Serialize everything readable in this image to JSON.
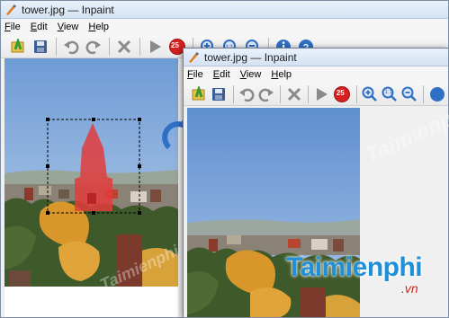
{
  "window_back": {
    "title": "tower.jpg — Inpaint",
    "menus": [
      "File",
      "Edit",
      "View",
      "Help"
    ],
    "menu_underline": [
      "F",
      "E",
      "V",
      "H"
    ],
    "badge_value": "25"
  },
  "window_front": {
    "title": "tower.jpg — Inpaint",
    "menus": [
      "File",
      "Edit",
      "View",
      "Help"
    ],
    "menu_underline": [
      "F",
      "E",
      "V",
      "H"
    ],
    "badge_value": "25",
    "zoom_reset_label": "1:1"
  },
  "watermark": {
    "brand": "Taimienphi",
    "tld": ".vn"
  },
  "colors": {
    "selection_mask": "#e23c3c",
    "toolbar_blue": "#2f6fc6",
    "badge_red": "#d62020",
    "sky": "#7fa6d9",
    "foliage": "#d9962a",
    "brand_blue": "#1f8fd8"
  },
  "icons": [
    "app-icon",
    "open-icon",
    "save-icon",
    "undo-icon",
    "redo-icon",
    "clear-icon",
    "run-icon",
    "brush-size-icon",
    "zoom-in-icon",
    "zoom-reset-icon",
    "zoom-out-icon",
    "info-icon",
    "help-icon",
    "rotate-arrow-icon"
  ]
}
